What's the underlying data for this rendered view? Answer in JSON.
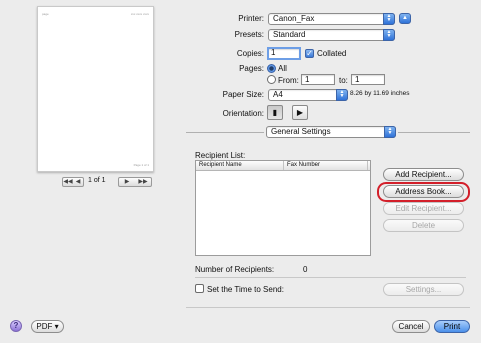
{
  "preview": {
    "header_left": "page",
    "header_right": "xxx xxxx xxxx",
    "footer": "Page 1 of 1",
    "nav_first": "◀◀",
    "nav_prev": "◀",
    "page_indicator": "1 of 1",
    "nav_next": "▶",
    "nav_last": "▶▶"
  },
  "printer": {
    "label": "Printer:",
    "value": "Canon_Fax"
  },
  "presets": {
    "label": "Presets:",
    "value": "Standard"
  },
  "copies": {
    "label": "Copies:",
    "value": "1",
    "collated_label": "Collated",
    "collated": true
  },
  "pages": {
    "label": "Pages:",
    "all_label": "All",
    "from_label": "From:",
    "from_value": "1",
    "to_label": "to:",
    "to_value": "1"
  },
  "paper_size": {
    "label": "Paper Size:",
    "value": "A4",
    "dimensions": "8.26 by 11.69 inches"
  },
  "orientation": {
    "label": "Orientation:"
  },
  "section": {
    "value": "General Settings"
  },
  "recipient_list": {
    "label": "Recipient List:",
    "columns": [
      "Recipient Name",
      "Fax Number"
    ]
  },
  "buttons": {
    "add_recipient": "Add Recipient...",
    "address_book": "Address Book...",
    "edit_recipient": "Edit Recipient...",
    "delete": "Delete",
    "settings": "Settings...",
    "pdf": "PDF ▾",
    "cancel": "Cancel",
    "print": "Print"
  },
  "number_of_recipients": {
    "label": "Number of Recipients:",
    "value": "0"
  },
  "send_time": {
    "label": "Set the Time to Send:"
  },
  "help": "?"
}
